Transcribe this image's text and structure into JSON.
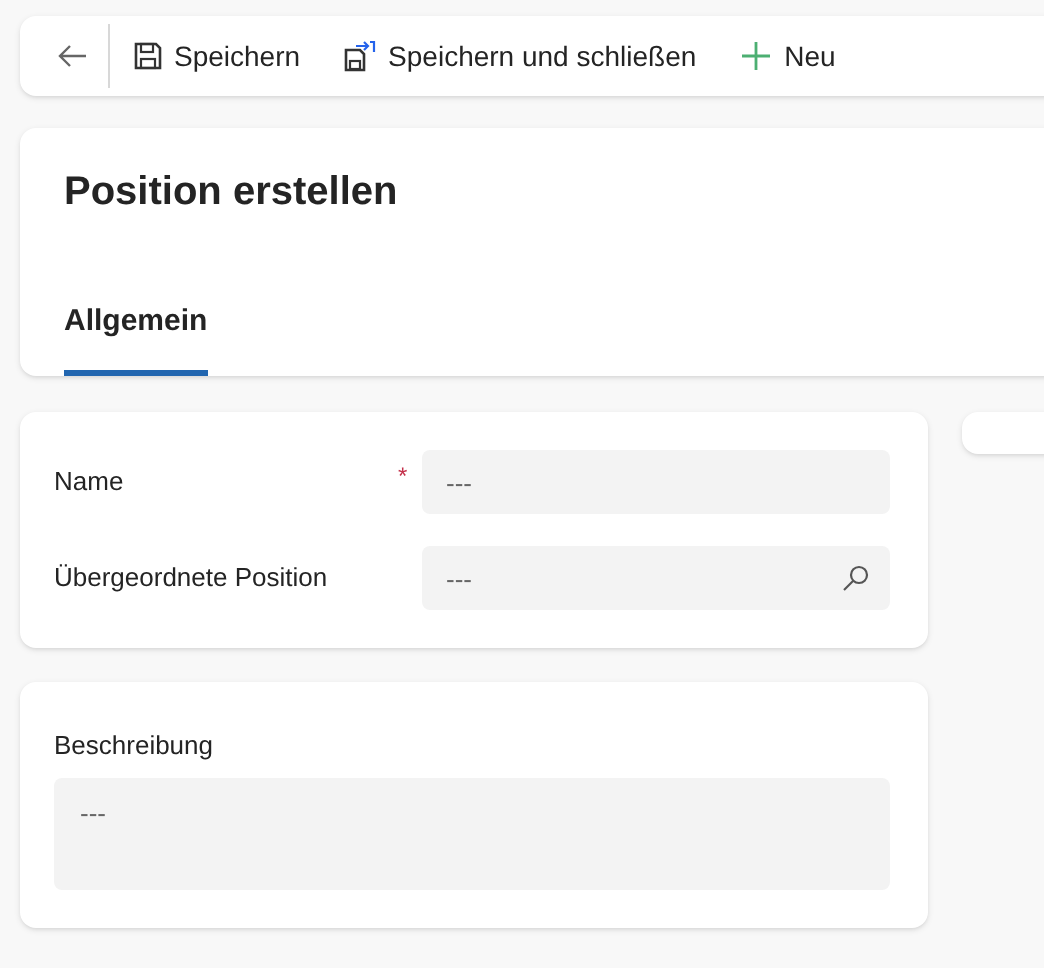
{
  "toolbar": {
    "buttons": [
      {
        "kind": "back"
      },
      {
        "kind": "save",
        "label": "Speichern"
      },
      {
        "kind": "save_close",
        "label": "Speichern und schließen"
      },
      {
        "kind": "new",
        "label": "Neu"
      }
    ]
  },
  "header": {
    "title": "Position erstellen",
    "tabs": [
      {
        "label": "Allgemein",
        "selected": true
      }
    ]
  },
  "fields": [
    {
      "label": "Name",
      "required_mark": "*",
      "kind": "text",
      "placeholder": "---"
    },
    {
      "label": "Übergeordnete Position",
      "kind": "lookup",
      "placeholder": "---"
    }
  ],
  "description": {
    "label": "Beschreibung",
    "placeholder": "---"
  }
}
